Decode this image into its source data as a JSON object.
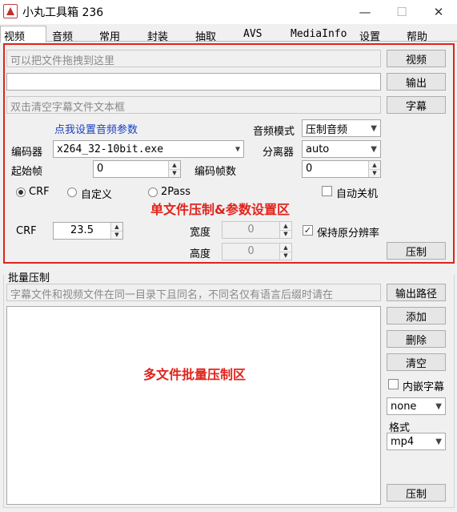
{
  "window": {
    "title": "小丸工具箱 236",
    "minimize_glyph": "—",
    "maximize_glyph": "☐",
    "close_glyph": "✕"
  },
  "menu": [
    "视频",
    "音频",
    "常用",
    "封装",
    "抽取",
    "AVS",
    "MediaInfo",
    "设置",
    "帮助"
  ],
  "single": {
    "video_placeholder": "可以把文件拖拽到这里",
    "video_btn": "视频",
    "output_value": "",
    "output_btn": "输出",
    "subtitle_placeholder": "双击清空字幕文件文本框",
    "subtitle_btn": "字幕",
    "audio_params_link": "点我设置音频参数",
    "audio_mode_label": "音频模式",
    "audio_mode_value": "压制音频",
    "encoder_label": "编码器",
    "encoder_value": "x264_32-10bit.exe",
    "demuxer_label": "分离器",
    "demuxer_value": "auto",
    "start_frame_label": "起始帧",
    "start_frame_value": "0",
    "encode_frames_label": "编码帧数",
    "encode_frames_value": "0",
    "mode_crf": "CRF",
    "mode_custom": "自定义",
    "mode_2pass": "2Pass",
    "auto_shutdown": "自动关机",
    "crf_label": "CRF",
    "crf_value": "23.5",
    "width_label": "宽度",
    "width_value": "0",
    "height_label": "高度",
    "height_value": "0",
    "keep_res_label": "保持原分辨率",
    "keep_res_check": "✓",
    "compress_btn": "压制",
    "annotation": "单文件压制&参数设置区"
  },
  "batch": {
    "group_label": "批量压制",
    "hint": "字幕文件和视频文件在同一目录下且同名，不同名仅有语言后缀时请在",
    "output_path_btn": "输出路径",
    "add_btn": "添加",
    "delete_btn": "删除",
    "clear_btn": "清空",
    "embed_sub_label": "内嵌字幕",
    "sub_combo_value": "none",
    "format_label": "格式",
    "format_value": "mp4",
    "compress_btn": "压制",
    "annotation": "多文件批量压制区"
  },
  "colors": {
    "annotation_red": "#e0231c",
    "link_blue": "#1a3fbf"
  }
}
